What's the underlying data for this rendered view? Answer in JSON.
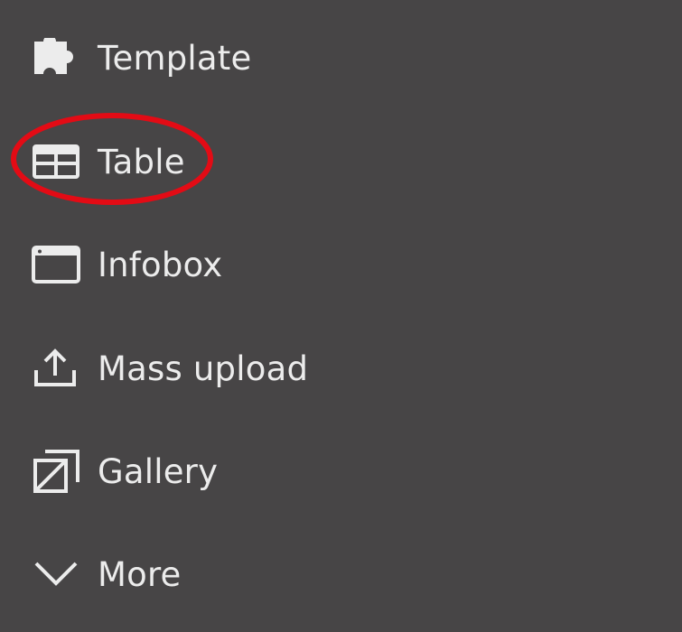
{
  "menu": {
    "items": [
      {
        "label": "Template",
        "icon": "puzzle-piece-icon"
      },
      {
        "label": "Table",
        "icon": "table-grid-icon"
      },
      {
        "label": "Infobox",
        "icon": "window-infobox-icon"
      },
      {
        "label": "Mass upload",
        "icon": "upload-icon"
      },
      {
        "label": "Gallery",
        "icon": "gallery-icon"
      },
      {
        "label": "More",
        "icon": "chevron-down-icon"
      }
    ]
  },
  "colors": {
    "background": "#474546",
    "text": "#ececec",
    "highlight": "#e30b15"
  }
}
